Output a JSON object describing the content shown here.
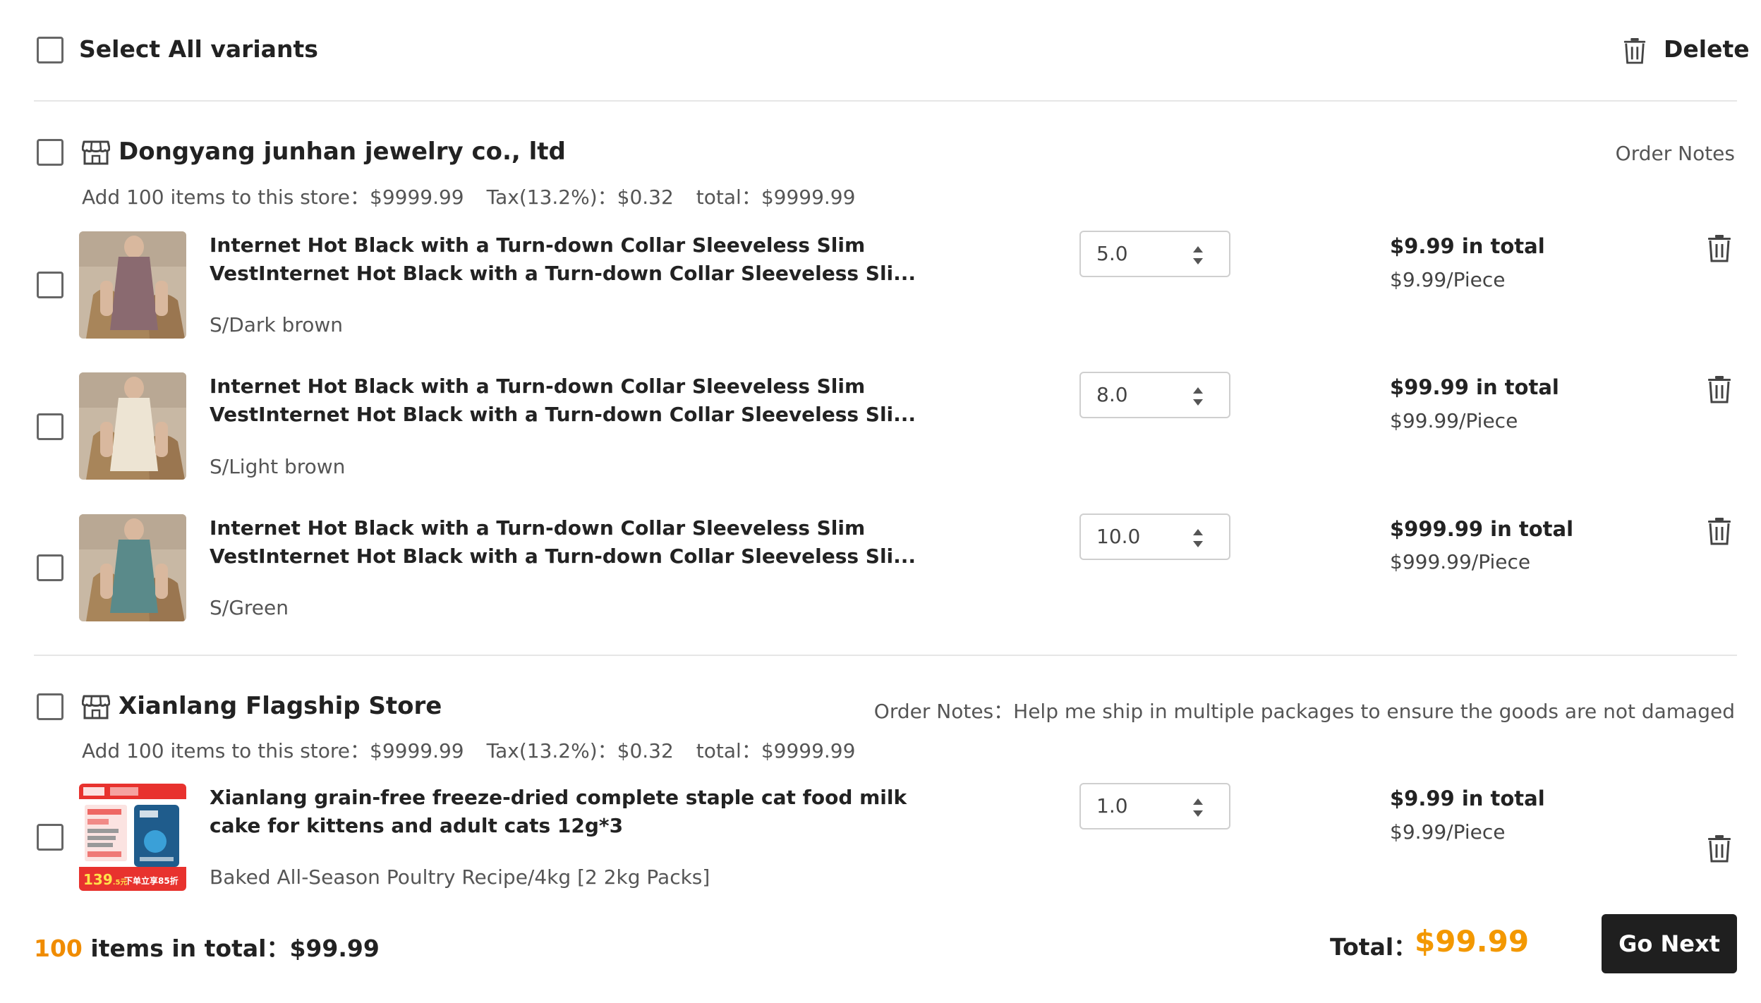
{
  "header": {
    "select_all_label": "Select All variants",
    "delete_label": "Delete"
  },
  "stores": [
    {
      "name": "Dongyang junhan jewelry co., ltd",
      "order_notes": "Order Notes",
      "summary_add": "Add 100 items to this store：$9999.99",
      "summary_tax": "Tax(13.2%)：$0.32",
      "summary_total": "total：$9999.99",
      "items": [
        {
          "title": "Internet Hot Black with a Turn-down Collar Sleeveless Slim VestInternet Hot Black with a Turn-down Collar Sleeveless Sli...",
          "variant": "S/Dark brown",
          "qty": "5.0",
          "total": "$9.99 in total",
          "per_piece": "$9.99/Piece",
          "dress_color": "#8a6a70"
        },
        {
          "title": "Internet Hot Black with a Turn-down Collar Sleeveless Slim VestInternet Hot Black with a Turn-down Collar Sleeveless Sli...",
          "variant": "S/Light brown",
          "qty": "8.0",
          "total": "$99.99 in total",
          "per_piece": "$99.99/Piece",
          "dress_color": "#ede4d3"
        },
        {
          "title": "Internet Hot Black with a Turn-down Collar Sleeveless Slim VestInternet Hot Black with a Turn-down Collar Sleeveless Sli...",
          "variant": "S/Green",
          "qty": "10.0",
          "total": "$999.99 in total",
          "per_piece": "$999.99/Piece",
          "dress_color": "#5a8a8a"
        }
      ]
    },
    {
      "name": "Xianlang Flagship Store",
      "order_notes": "Order Notes：Help me ship in multiple packages to ensure the goods are not damaged",
      "summary_add": "Add 100 items to this store：$9999.99",
      "summary_tax": "Tax(13.2%)：$0.32",
      "summary_total": "total：$9999.99",
      "items": [
        {
          "title": "Xianlang grain-free freeze-dried complete staple cat food milk cake for kittens and adult cats 12g*3",
          "variant": "Baked All-Season Poultry Recipe/4kg [2 2kg Packs]",
          "qty": "1.0",
          "total": "$9.99 in total",
          "per_piece": "$9.99/Piece",
          "thumb_price": "139",
          "thumb_price_unit": ".5元",
          "thumb_promo": "下单立享85折"
        }
      ]
    }
  ],
  "footer": {
    "count": "100",
    "items_label": " items in total：$99.99",
    "total_label": "Total：",
    "total_value": "$99.99",
    "go_next_label": "Go Next"
  },
  "colors": {
    "accent_orange": "#f39800",
    "button_dark": "#1f1f1f"
  },
  "icons": {
    "store": "store-icon",
    "trash": "trash-icon",
    "spinner": "spinner-arrows-icon"
  }
}
